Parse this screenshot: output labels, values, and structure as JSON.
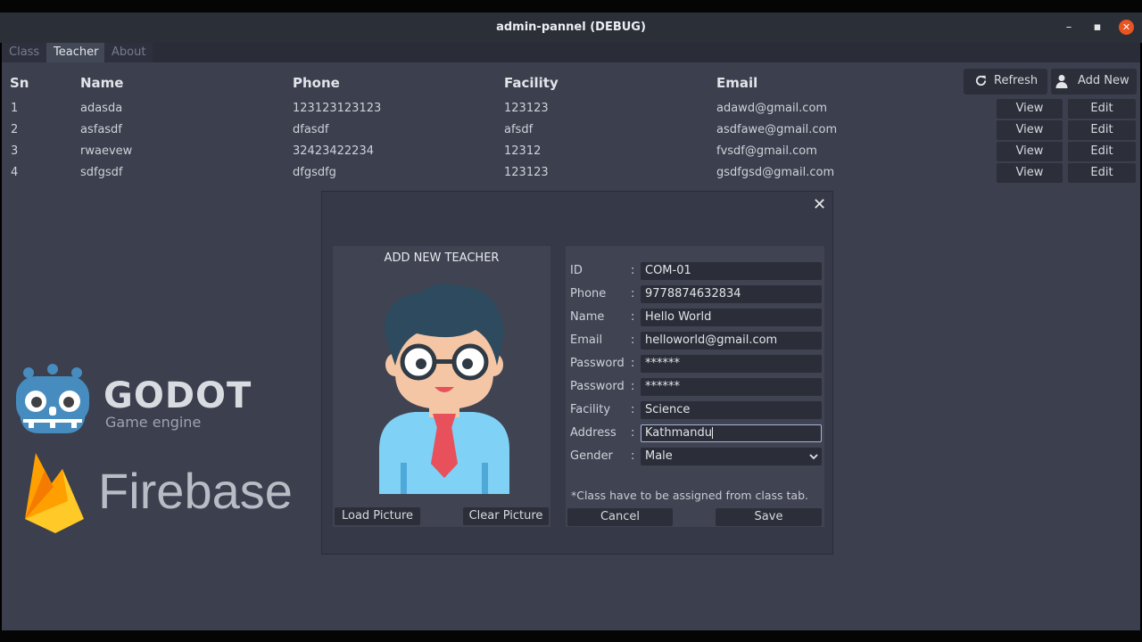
{
  "window": {
    "title": "admin-pannel (DEBUG)",
    "minimize_glyph": "–",
    "maximize_glyph": "▪",
    "close_glyph": "✕"
  },
  "tabs": [
    {
      "label": "Class"
    },
    {
      "label": "Teacher"
    },
    {
      "label": "About"
    }
  ],
  "table": {
    "columns": [
      "Sn",
      "Name",
      "Phone",
      "Facility",
      "Email"
    ],
    "rows": [
      {
        "sn": "1",
        "name": "adasda",
        "phone": "123123123123",
        "facility": "123123",
        "email": "adawd@gmail.com"
      },
      {
        "sn": "2",
        "name": "asfasdf",
        "phone": "dfasdf",
        "facility": "afsdf",
        "email": "asdfawe@gmail.com"
      },
      {
        "sn": "3",
        "name": "rwaevew",
        "phone": "32423422234",
        "facility": "12312",
        "email": "fvsdf@gmail.com"
      },
      {
        "sn": "4",
        "name": "sdfgsdf",
        "phone": "dfgsdfg",
        "facility": "123123",
        "email": "gsdfgsd@gmail.com"
      }
    ],
    "view_label": "View",
    "edit_label": "Edit"
  },
  "toolbar": {
    "refresh_label": "Refresh",
    "add_new_label": "Add New"
  },
  "logos": {
    "godot_title": "GODOT",
    "godot_subtitle": "Game engine",
    "firebase_title": "Firebase"
  },
  "dialog": {
    "close_glyph": "✕",
    "heading": "ADD NEW TEACHER",
    "load_picture_label": "Load Picture",
    "clear_picture_label": "Clear Picture",
    "colon": ":",
    "fields": [
      {
        "label": "ID",
        "value": "COM-01"
      },
      {
        "label": "Phone",
        "value": "9778874632834"
      },
      {
        "label": "Name",
        "value": "Hello World"
      },
      {
        "label": "Email",
        "value": "helloworld@gmail.com"
      },
      {
        "label": "Password",
        "value": "******"
      },
      {
        "label": "Password",
        "value": "******"
      },
      {
        "label": "Facility",
        "value": "Science"
      },
      {
        "label": "Address",
        "value": "Kathmandu"
      },
      {
        "label": "Gender",
        "value": "Male"
      }
    ],
    "note": "*Class have to be assigned from class tab.",
    "cancel_label": "Cancel",
    "save_label": "Save"
  }
}
